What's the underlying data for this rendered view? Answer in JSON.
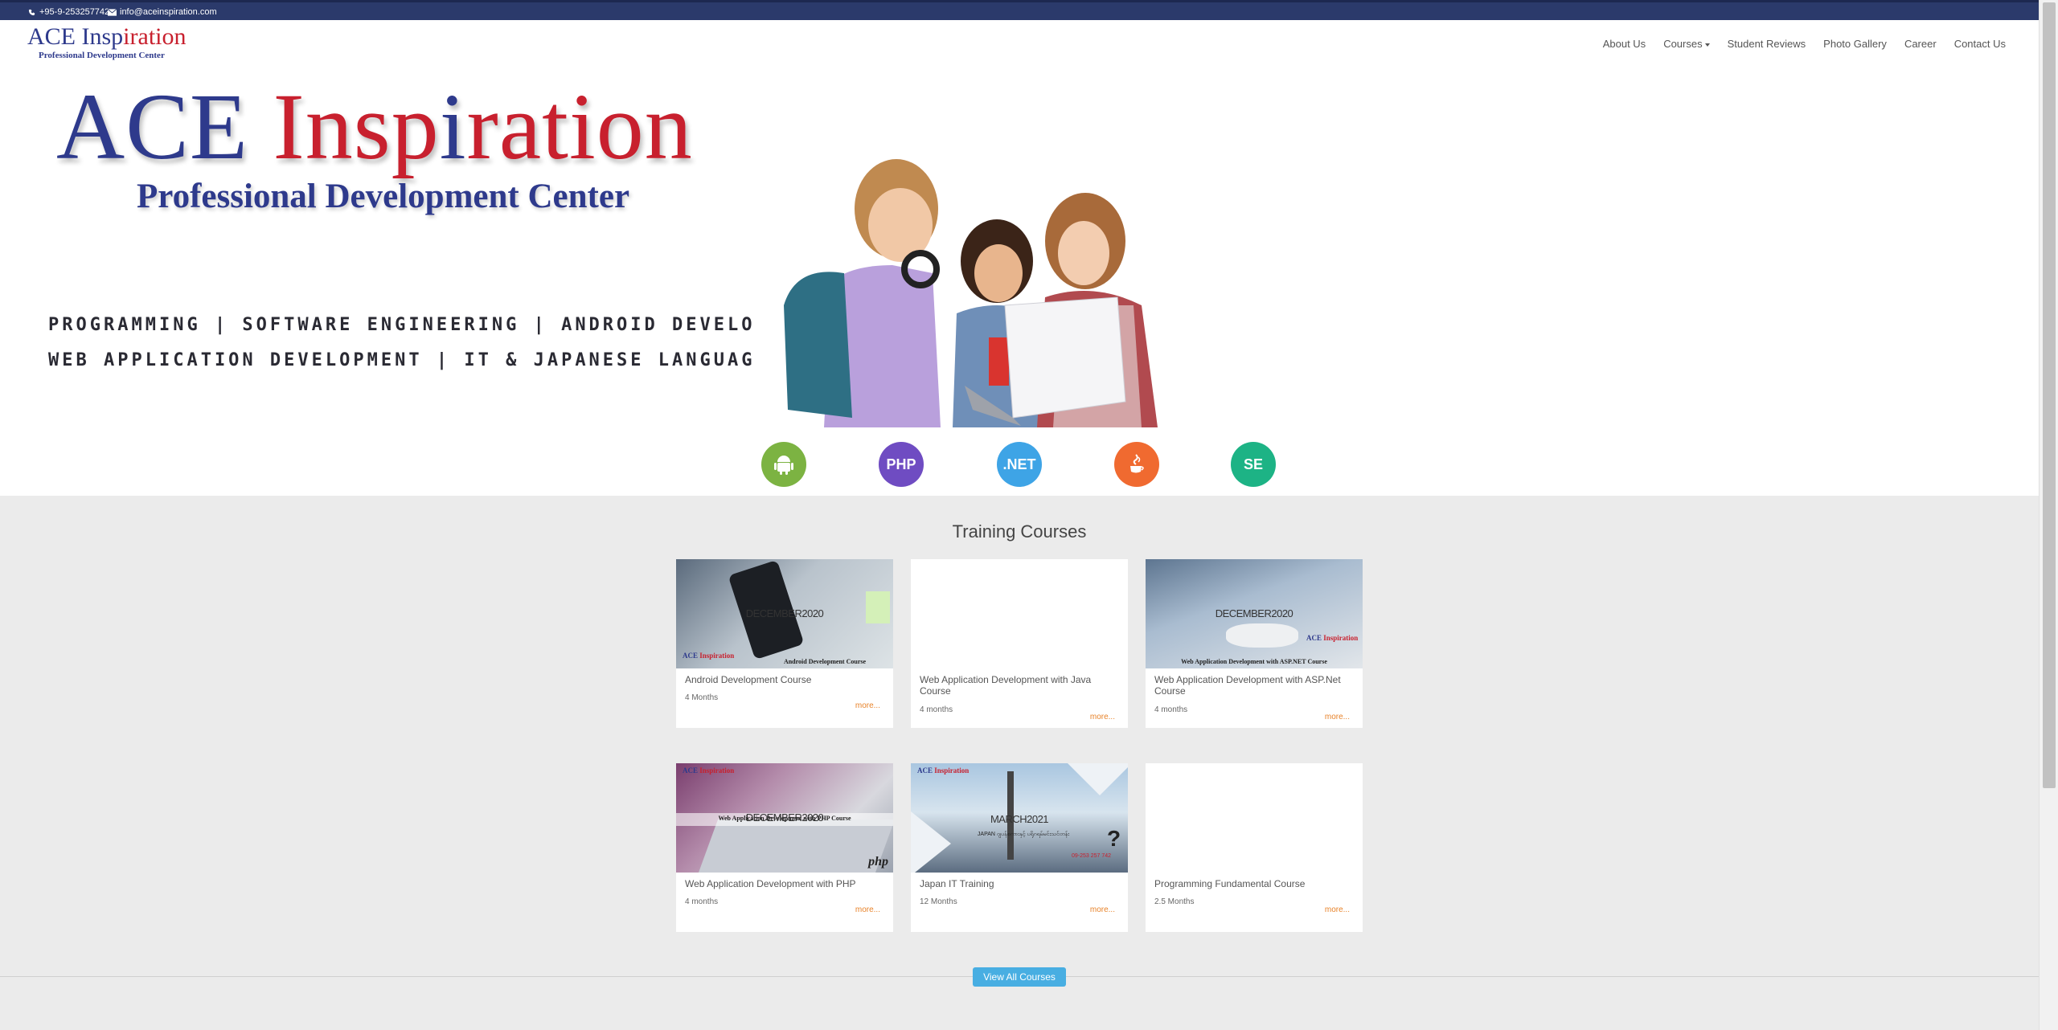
{
  "topbar": {
    "phone": "+95-9-253257742",
    "email": "info@aceinspiration.com"
  },
  "logo": {
    "part1": "ACE Insp",
    "part2": "i",
    "part3": "ration",
    "subtitle": "Professional Development Center"
  },
  "nav": {
    "items": [
      {
        "label": "About Us"
      },
      {
        "label": "Courses"
      },
      {
        "label": "Student Reviews"
      },
      {
        "label": "Photo Gallery"
      },
      {
        "label": "Career"
      },
      {
        "label": "Contact Us"
      }
    ]
  },
  "hero": {
    "title_ace": "ACE ",
    "title_insp": "Insp",
    "title_i": "i",
    "title_ration": "ration",
    "subtitle": "Professional Development Center",
    "line1": "PROGRAMMING  |  SOFTWARE ENGINEERING  |  ANDROID DEVELOPMENT",
    "line2": "WEB APPLICATION DEVELOPMENT  |  IT & JAPANESE LANGUAGE TRAINING"
  },
  "icons": {
    "php": "PHP",
    "net": ".NET",
    "se": "SE",
    "colors": {
      "android": "#7cb342",
      "php": "#6f4cc2",
      "net": "#3ea4e6",
      "java": "#f06a30",
      "se": "#1db385"
    }
  },
  "section": {
    "title": "Training Courses",
    "view_all": "View All Courses",
    "more_label": "more..."
  },
  "courses": [
    {
      "title": "Android Development Course",
      "duration": "4 Months",
      "month": "DECEMBER2020",
      "caption": "Android Development Course"
    },
    {
      "title": "Web Application Development with Java Course",
      "duration": "4 months"
    },
    {
      "title": "Web Application Development with ASP.Net Course",
      "duration": "4 months",
      "month": "DECEMBER2020",
      "caption": "Web Application Development with ASP.NET Course"
    },
    {
      "title": "Web Application Development with PHP",
      "duration": "4 months",
      "month": "DECEMBER2020",
      "caption": "Web Application Development with PHP Course",
      "tag": "php"
    },
    {
      "title": "Japan IT Training",
      "duration": "12 Months",
      "month": "MARCH2021",
      "caption": "JAPAN ဂျပန်စကားနှင့် ပရိုဂရမ်မင်းသင်တန်း",
      "phone": "09-253 257 742"
    },
    {
      "title": "Programming Fundamental Course",
      "duration": "2.5 Months"
    }
  ],
  "brand_small": {
    "a": "ACE ",
    "b": "Inspiration"
  }
}
